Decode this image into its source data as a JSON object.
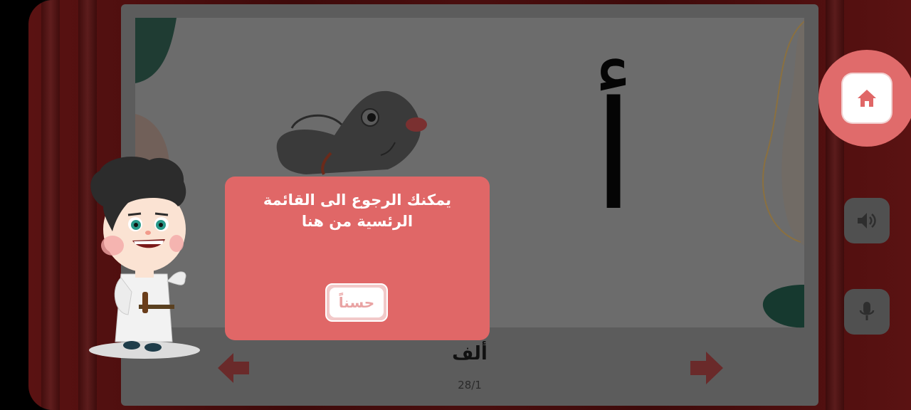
{
  "lesson": {
    "letter": "أ",
    "word": "ألف",
    "counter": "28/1"
  },
  "dialog": {
    "message": "يمكنك الرجوع الى القائمة\nالرئسية من هنا",
    "ok_label": "حسناً"
  },
  "controls": {
    "home_icon": "home-icon",
    "sound_icon": "speaker-icon",
    "mic_icon": "microphone-icon",
    "prev_icon": "arrow-left-icon",
    "next_icon": "arrow-right-icon"
  },
  "colors": {
    "dialog": "#e06767",
    "home_circle": "#e06b6b",
    "accent": "#e9a3a3"
  }
}
